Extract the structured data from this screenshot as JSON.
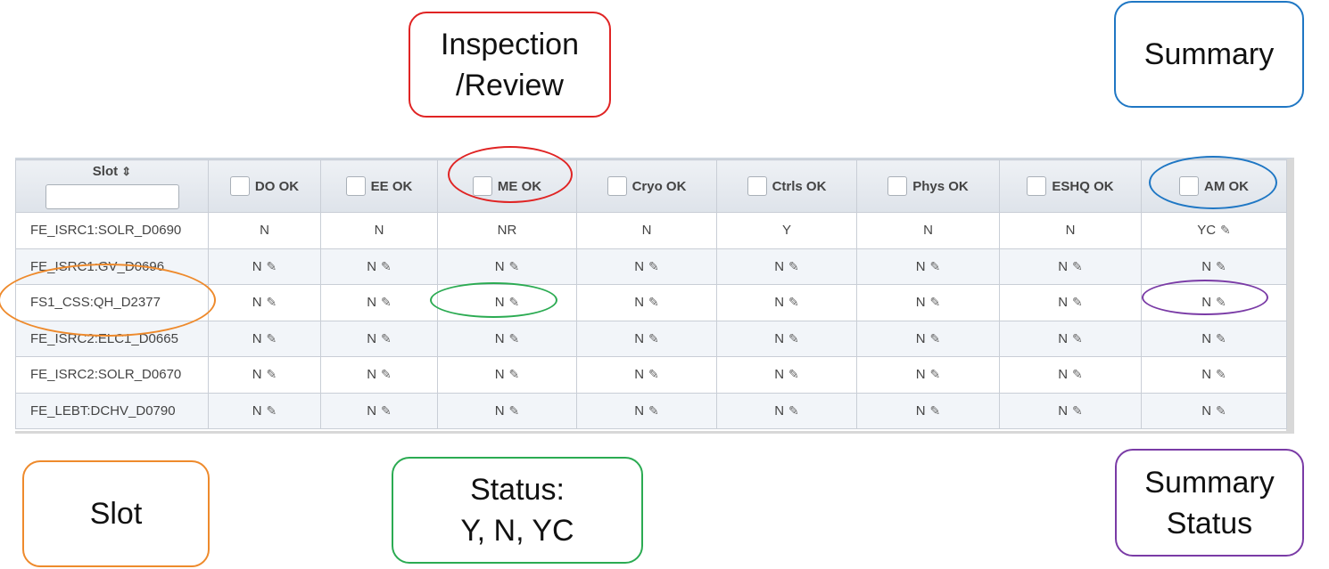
{
  "callouts": {
    "inspection": {
      "text": "Inspection\n/Review",
      "color": "#e02424"
    },
    "summary": {
      "text": "Summary",
      "color": "#1f77c4"
    },
    "slot": {
      "text": "Slot",
      "color": "#ee8a2c"
    },
    "status": {
      "text": "Status:\nY, N, YC",
      "color": "#2bab52"
    },
    "summary_status": {
      "text": "Summary\nStatus",
      "color": "#7a3ba6"
    }
  },
  "table": {
    "slot_header": "Slot",
    "columns": [
      "DO OK",
      "EE OK",
      "ME OK",
      "Cryo OK",
      "Ctrls OK",
      "Phys OK",
      "ESHQ OK",
      "AM OK"
    ],
    "rows": [
      {
        "slot": "FE_ISRC1:SOLR_D0690",
        "cells": [
          {
            "v": "N",
            "edit": false
          },
          {
            "v": "N",
            "edit": false
          },
          {
            "v": "NR",
            "edit": false
          },
          {
            "v": "N",
            "edit": false
          },
          {
            "v": "Y",
            "edit": false
          },
          {
            "v": "N",
            "edit": false
          },
          {
            "v": "N",
            "edit": false
          },
          {
            "v": "YC",
            "edit": true
          }
        ]
      },
      {
        "slot": "FE_ISRC1:GV_D0696",
        "cells": [
          {
            "v": "N",
            "edit": true
          },
          {
            "v": "N",
            "edit": true
          },
          {
            "v": "N",
            "edit": true
          },
          {
            "v": "N",
            "edit": true
          },
          {
            "v": "N",
            "edit": true
          },
          {
            "v": "N",
            "edit": true
          },
          {
            "v": "N",
            "edit": true
          },
          {
            "v": "N",
            "edit": true
          }
        ]
      },
      {
        "slot": "FS1_CSS:QH_D2377",
        "cells": [
          {
            "v": "N",
            "edit": true
          },
          {
            "v": "N",
            "edit": true
          },
          {
            "v": "N",
            "edit": true
          },
          {
            "v": "N",
            "edit": true
          },
          {
            "v": "N",
            "edit": true
          },
          {
            "v": "N",
            "edit": true
          },
          {
            "v": "N",
            "edit": true
          },
          {
            "v": "N",
            "edit": true
          }
        ]
      },
      {
        "slot": "FE_ISRC2:ELC1_D0665",
        "cells": [
          {
            "v": "N",
            "edit": true
          },
          {
            "v": "N",
            "edit": true
          },
          {
            "v": "N",
            "edit": true
          },
          {
            "v": "N",
            "edit": true
          },
          {
            "v": "N",
            "edit": true
          },
          {
            "v": "N",
            "edit": true
          },
          {
            "v": "N",
            "edit": true
          },
          {
            "v": "N",
            "edit": true
          }
        ]
      },
      {
        "slot": "FE_ISRC2:SOLR_D0670",
        "cells": [
          {
            "v": "N",
            "edit": true
          },
          {
            "v": "N",
            "edit": true
          },
          {
            "v": "N",
            "edit": true
          },
          {
            "v": "N",
            "edit": true
          },
          {
            "v": "N",
            "edit": true
          },
          {
            "v": "N",
            "edit": true
          },
          {
            "v": "N",
            "edit": true
          },
          {
            "v": "N",
            "edit": true
          }
        ]
      },
      {
        "slot": "FE_LEBT:DCHV_D0790",
        "cells": [
          {
            "v": "N",
            "edit": true
          },
          {
            "v": "N",
            "edit": true
          },
          {
            "v": "N",
            "edit": true
          },
          {
            "v": "N",
            "edit": true
          },
          {
            "v": "N",
            "edit": true
          },
          {
            "v": "N",
            "edit": true
          },
          {
            "v": "N",
            "edit": true
          },
          {
            "v": "N",
            "edit": true
          }
        ]
      }
    ]
  },
  "icons": {
    "sort": "sort-icon",
    "edit": "edit-icon",
    "checkbox": "checkbox-icon"
  }
}
